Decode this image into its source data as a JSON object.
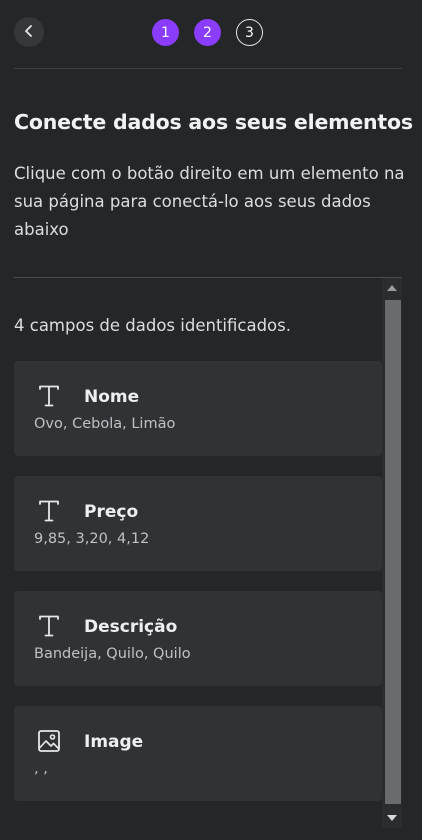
{
  "header": {
    "steps": [
      {
        "label": "1",
        "state": "done"
      },
      {
        "label": "2",
        "state": "done"
      },
      {
        "label": "3",
        "state": "current"
      }
    ]
  },
  "title": "Conecte dados aos seus elementos",
  "description": "Clique com o botão direito em um elemento na sua página para conectá-lo aos seus dados abaixo",
  "fields_count_text": "4 campos de dados identificados.",
  "fields": [
    {
      "icon": "text-icon",
      "name": "Nome",
      "values": "Ovo, Cebola, Limão"
    },
    {
      "icon": "text-icon",
      "name": "Preço",
      "values": "9,85, 3,20, 4,12"
    },
    {
      "icon": "text-icon",
      "name": "Descrição",
      "values": "Bandeija, Quilo, Quilo"
    },
    {
      "icon": "image-icon",
      "name": "Image",
      "values": ", ,"
    }
  ],
  "colors": {
    "accent": "#8b3dff",
    "background": "#252627",
    "card": "#313235"
  }
}
